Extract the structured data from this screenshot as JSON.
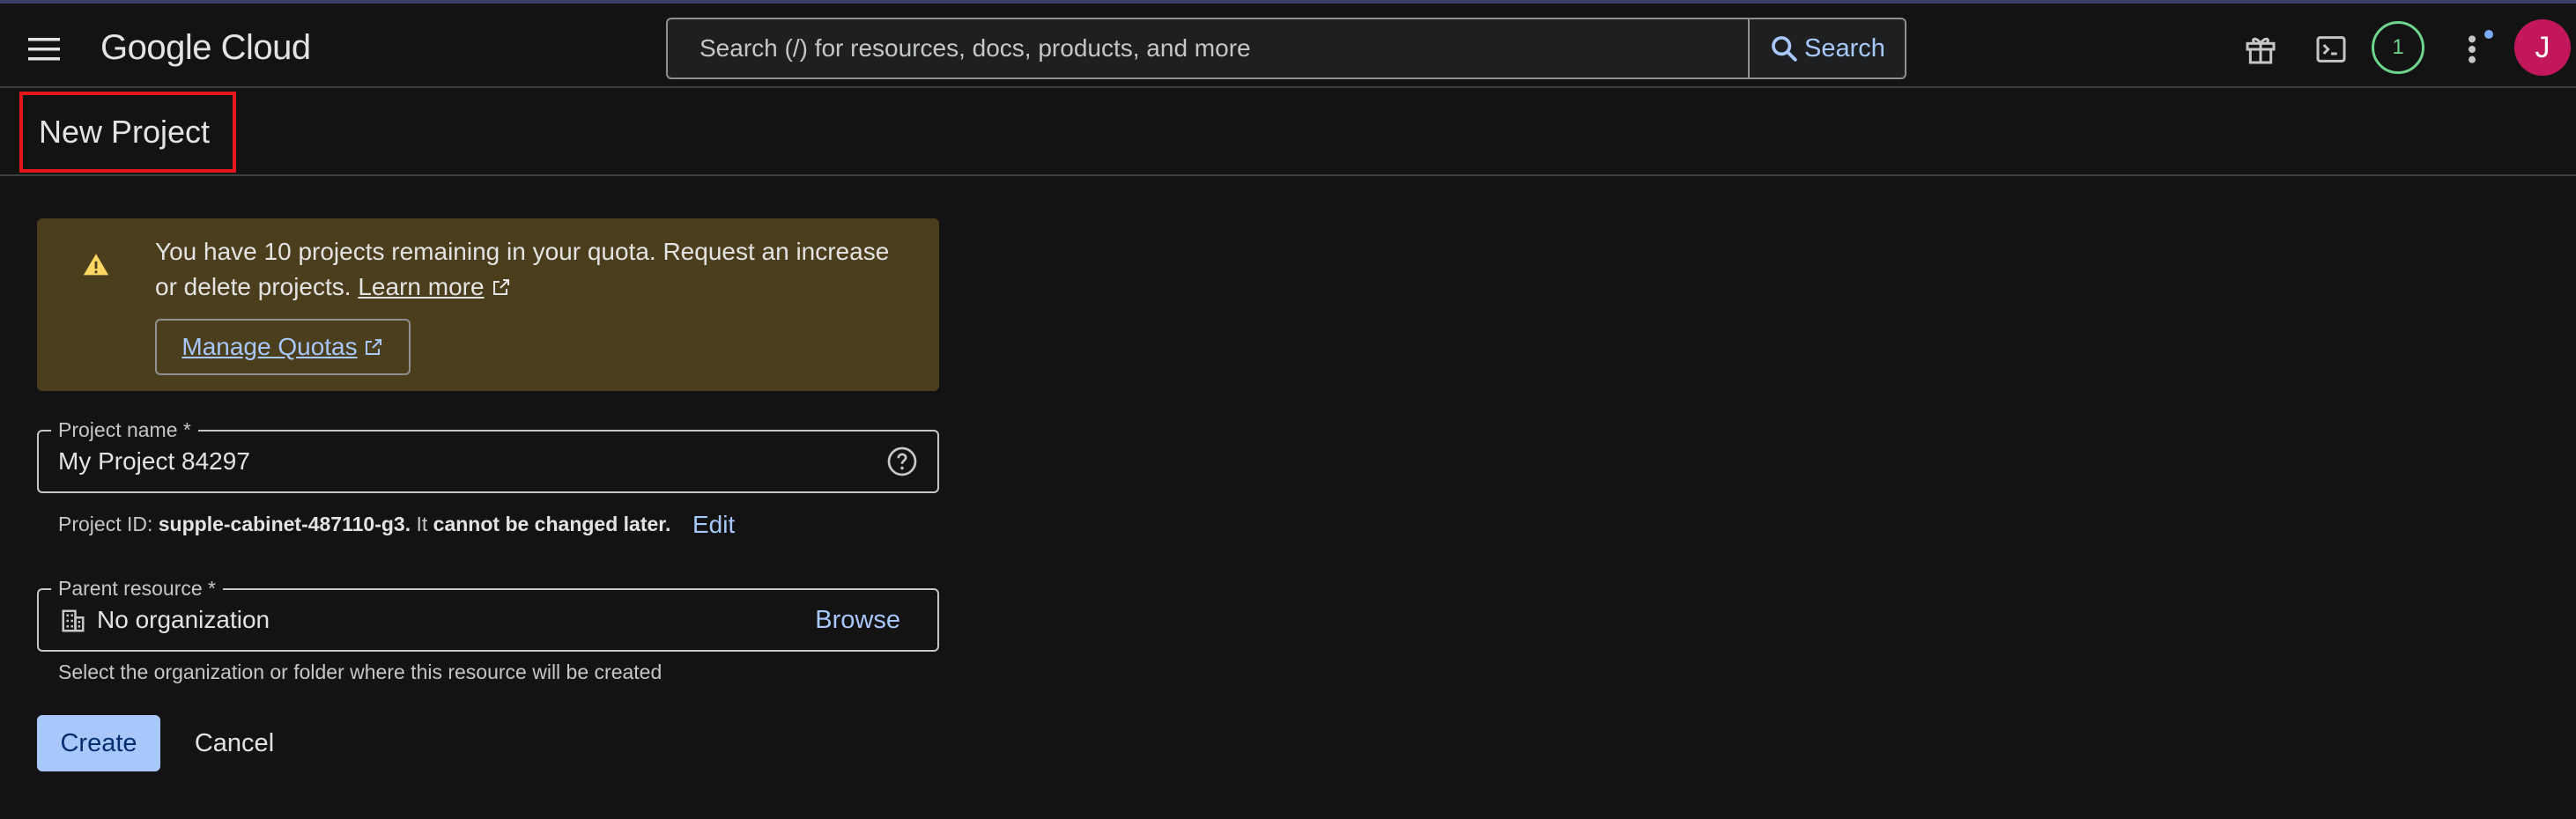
{
  "topbar": {
    "logo": "Google Cloud",
    "search_placeholder": "Search (/) for resources, docs, products, and more",
    "search_button": "Search",
    "notifications_count": "1",
    "avatar_initial": "J"
  },
  "page": {
    "title": "New Project"
  },
  "quota_banner": {
    "text": "You have 10 projects remaining in your quota. Request an increase or delete projects.",
    "learn_more": "Learn more",
    "manage_quotas": "Manage Quotas"
  },
  "form": {
    "project_name": {
      "label": "Project name *",
      "value": "My Project 84297"
    },
    "project_id": {
      "prefix": "Project ID:",
      "id": "supple-cabinet-487110-g3.",
      "mid": "It",
      "warning": "cannot be changed later.",
      "edit": "Edit"
    },
    "parent_resource": {
      "label": "Parent resource *",
      "value": "No organization",
      "browse": "Browse",
      "helper": "Select the organization or folder where this resource will be created"
    },
    "create": "Create",
    "cancel": "Cancel"
  },
  "colors": {
    "background": "#131314",
    "accent": "#a8c7fa",
    "banner": "#4b3e1d",
    "warning_icon": "#fdd663",
    "notification": "#6dd58c",
    "avatar": "#c2185b",
    "highlight_box": "#e3161b"
  },
  "icons": [
    "menu-icon",
    "search-icon",
    "gift-icon",
    "terminal-icon",
    "more-vert-icon",
    "warning-icon",
    "external-link-icon",
    "help-icon",
    "building-icon"
  ]
}
